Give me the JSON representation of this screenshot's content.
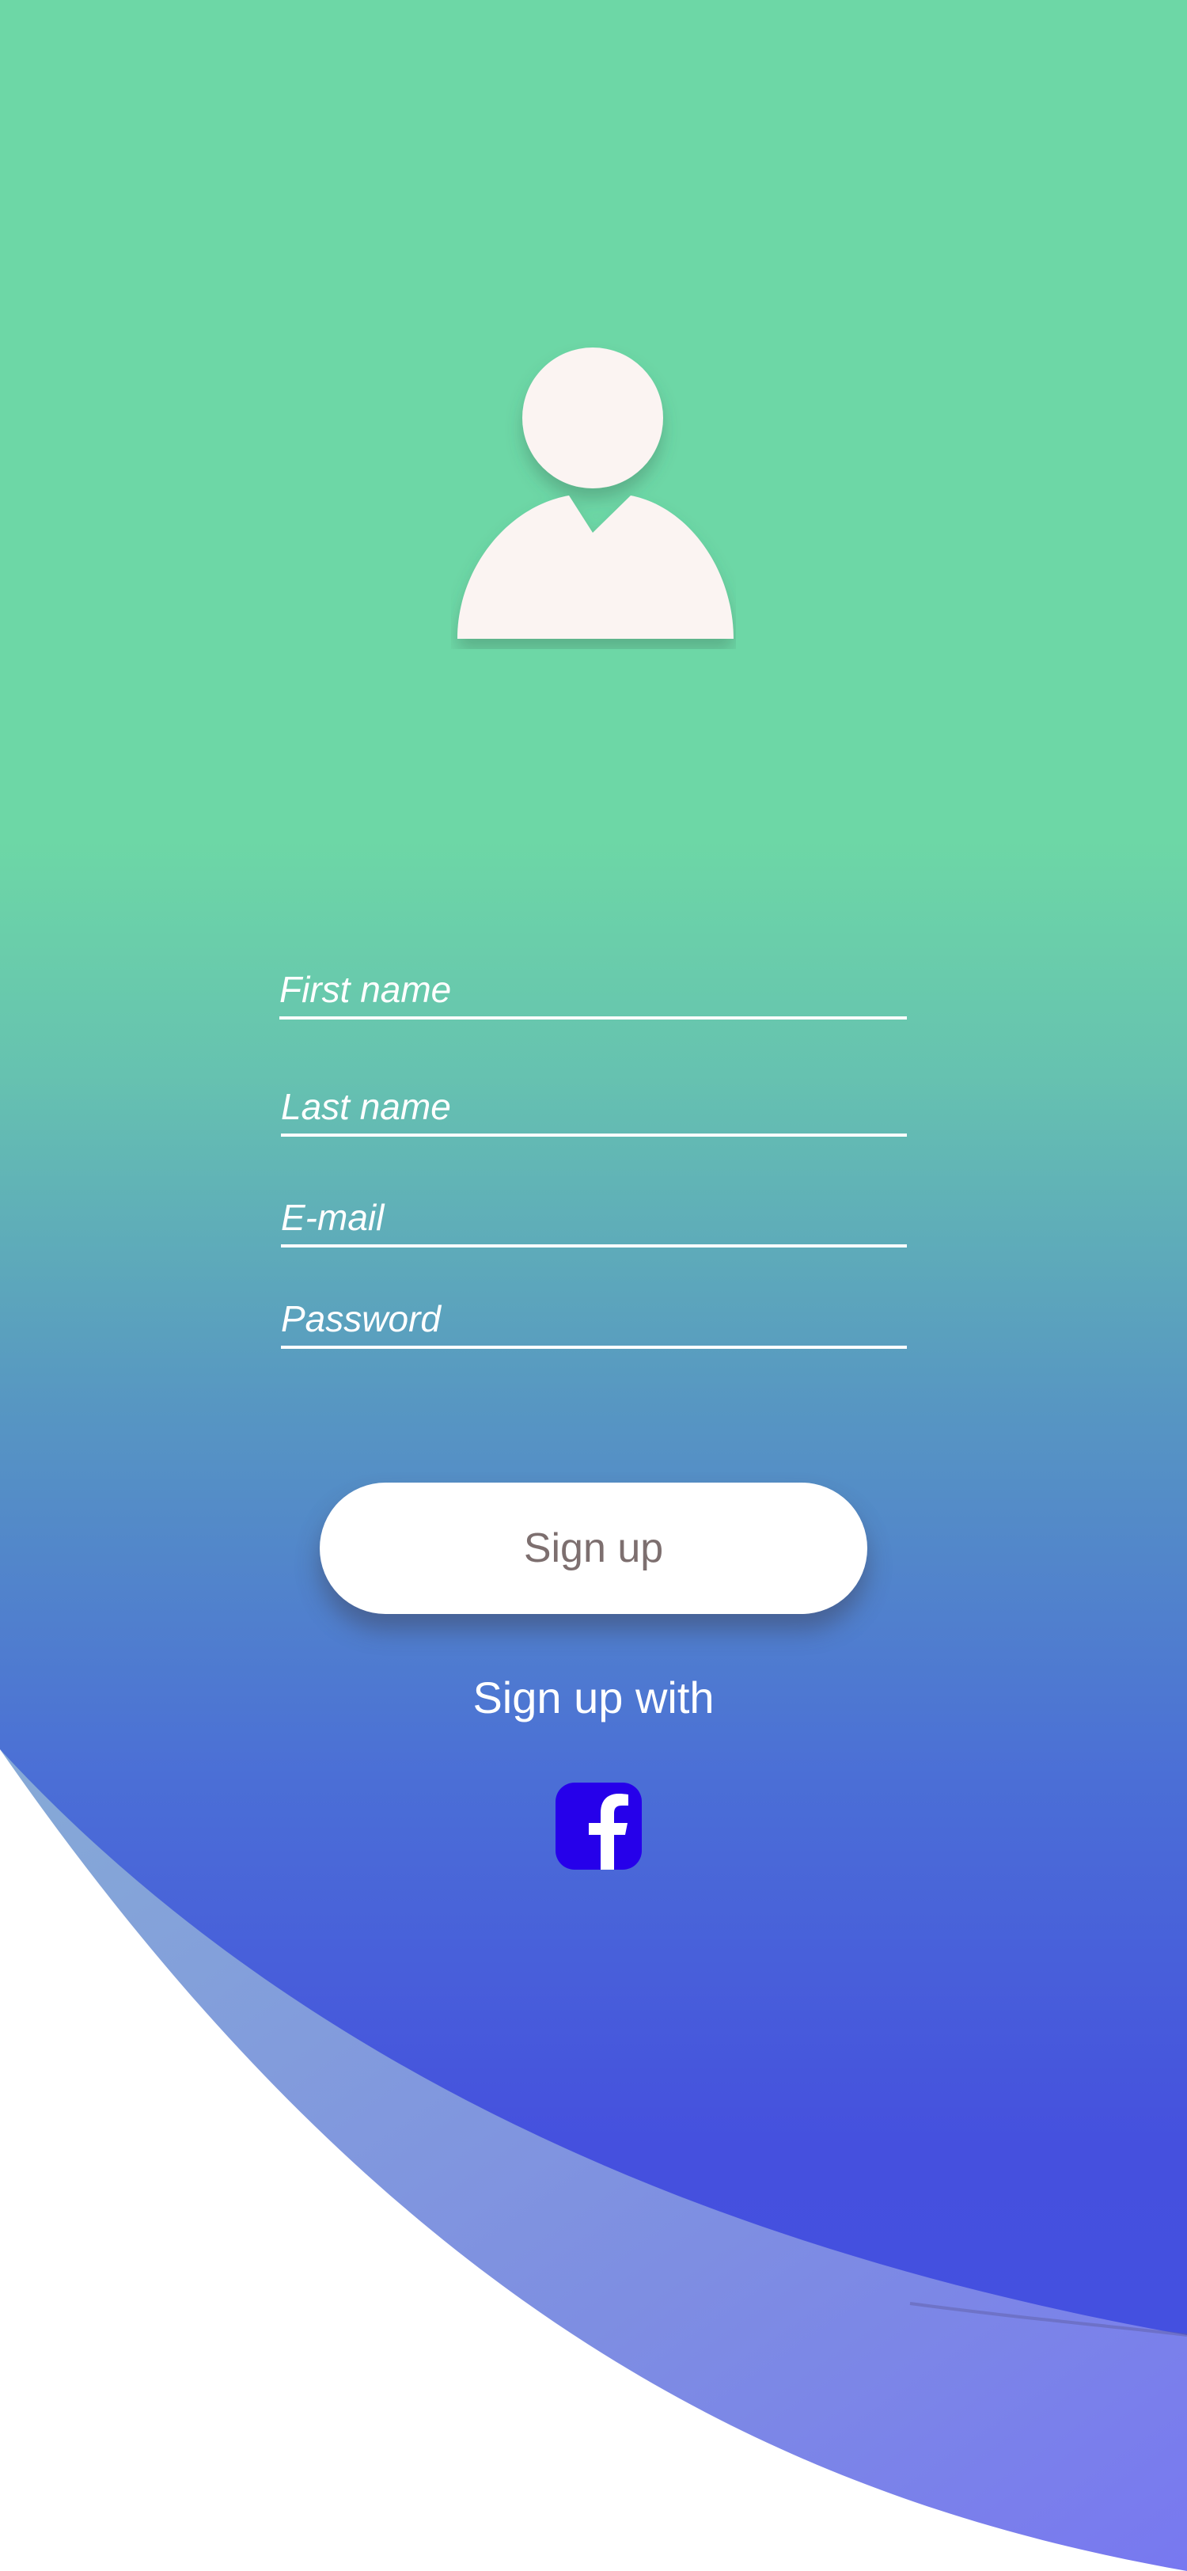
{
  "form": {
    "first_name_placeholder": "First name",
    "last_name_placeholder": "Last name",
    "email_placeholder": "E-mail",
    "password_placeholder": "Password"
  },
  "actions": {
    "signup_label": "Sign up",
    "signup_with_label": "Sign up with"
  },
  "social": {
    "facebook_icon": "facebook-icon"
  },
  "colors": {
    "gradient_top": "#6dd7a6",
    "gradient_mid": "#5b9bc0",
    "gradient_bottom": "#4550de",
    "wave_light": "#84a6d8",
    "wave_dark": "#7a7ef0",
    "facebook": "#2600ea",
    "button_text": "#7d6f6f",
    "avatar_fill": "#fbf4f2"
  }
}
